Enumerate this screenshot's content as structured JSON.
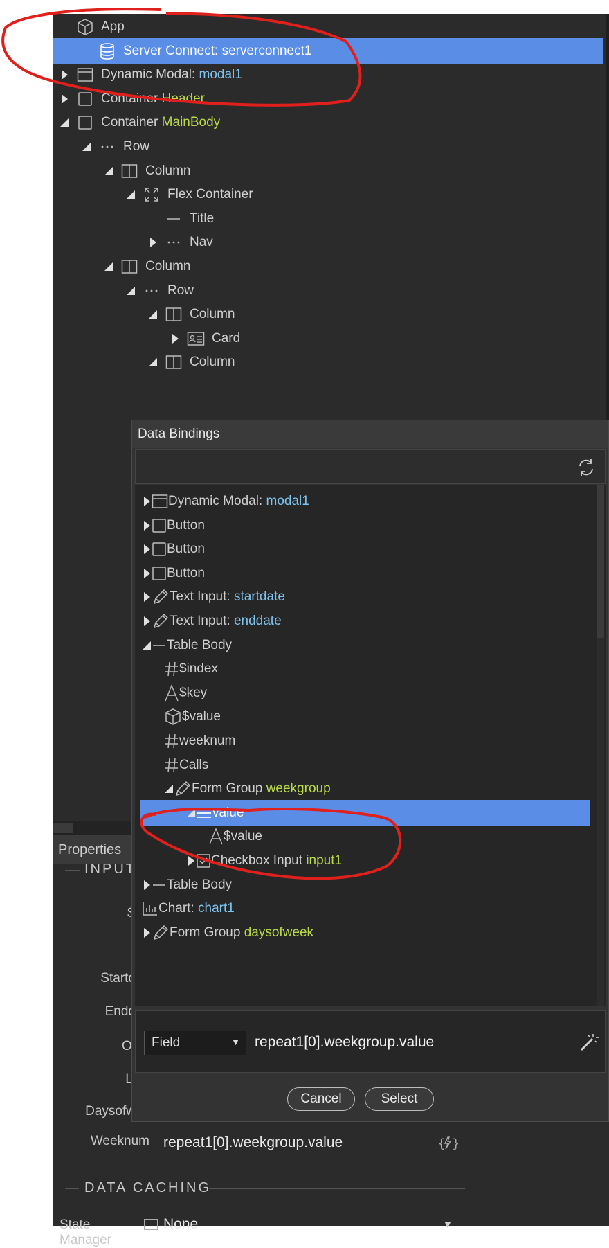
{
  "tree": {
    "items": [
      {
        "label": "App",
        "highlight": "",
        "hl_color": "",
        "icon": "cube-icon",
        "depth": 0,
        "toggle": "none",
        "selected": false
      },
      {
        "label": "Server Connect: serverconnect1",
        "highlight": "",
        "hl_color": "",
        "icon": "database-icon",
        "depth": 1,
        "toggle": "none",
        "selected": true
      },
      {
        "label": "Dynamic Modal: ",
        "highlight": "modal1",
        "hl_color": "blue",
        "icon": "modal-icon",
        "depth": 0,
        "toggle": "right",
        "selected": false
      },
      {
        "label": "Container ",
        "highlight": "Header",
        "hl_color": "green",
        "icon": "container-icon",
        "depth": 0,
        "toggle": "right",
        "selected": false
      },
      {
        "label": "Container ",
        "highlight": "MainBody",
        "hl_color": "green",
        "icon": "container-icon",
        "depth": 0,
        "toggle": "down",
        "selected": false
      },
      {
        "label": "Row",
        "highlight": "",
        "hl_color": "",
        "icon": "dots-icon",
        "depth": 1,
        "toggle": "down",
        "selected": false
      },
      {
        "label": "Column",
        "highlight": "",
        "hl_color": "",
        "icon": "column-icon",
        "depth": 2,
        "toggle": "down",
        "selected": false
      },
      {
        "label": "Flex Container",
        "highlight": "",
        "hl_color": "",
        "icon": "flex-icon",
        "depth": 3,
        "toggle": "down",
        "selected": false
      },
      {
        "label": "Title",
        "highlight": "",
        "hl_color": "",
        "icon": "dash-icon",
        "depth": 4,
        "toggle": "none",
        "selected": false
      },
      {
        "label": "Nav",
        "highlight": "",
        "hl_color": "",
        "icon": "dots-icon",
        "depth": 4,
        "toggle": "right",
        "selected": false
      },
      {
        "label": "Column",
        "highlight": "",
        "hl_color": "",
        "icon": "column-icon",
        "depth": 2,
        "toggle": "down",
        "selected": false
      },
      {
        "label": "Row",
        "highlight": "",
        "hl_color": "",
        "icon": "dots-icon",
        "depth": 3,
        "toggle": "down",
        "selected": false
      },
      {
        "label": "Column",
        "highlight": "",
        "hl_color": "",
        "icon": "column-icon",
        "depth": 4,
        "toggle": "down",
        "selected": false
      },
      {
        "label": "Card",
        "highlight": "",
        "hl_color": "",
        "icon": "card-icon",
        "depth": 5,
        "toggle": "right",
        "selected": false
      },
      {
        "label": "Column",
        "highlight": "",
        "hl_color": "",
        "icon": "column-icon",
        "depth": 4,
        "toggle": "down",
        "selected": false
      }
    ]
  },
  "properties": {
    "tab_label": "Properties",
    "section_input": "INPUT",
    "labels": [
      "S",
      "Startd",
      "Endd",
      "Of",
      "Li",
      "Daysofw"
    ],
    "weeknum_label": "Weeknum",
    "weeknum_value": "repeat1[0].weekgroup.value",
    "section_caching": "DATA CACHING",
    "state_manager_label": "State Manager",
    "state_manager_value": "None"
  },
  "modal": {
    "title": "Data Bindings",
    "items": [
      {
        "label": "Dynamic Modal: ",
        "highlight": "modal1",
        "hl_color": "blue",
        "icon": "modal-icon",
        "depth": 0,
        "toggle": "right",
        "selected": false
      },
      {
        "label": "Button",
        "highlight": "",
        "hl_color": "",
        "icon": "container-icon",
        "depth": 0,
        "toggle": "right",
        "selected": false
      },
      {
        "label": "Button",
        "highlight": "",
        "hl_color": "",
        "icon": "container-icon",
        "depth": 0,
        "toggle": "right",
        "selected": false
      },
      {
        "label": "Button",
        "highlight": "",
        "hl_color": "",
        "icon": "container-icon",
        "depth": 0,
        "toggle": "right",
        "selected": false
      },
      {
        "label": "Text Input: ",
        "highlight": "startdate",
        "hl_color": "blue",
        "icon": "pencil-icon",
        "depth": 0,
        "toggle": "right",
        "selected": false
      },
      {
        "label": "Text Input: ",
        "highlight": "enddate",
        "hl_color": "blue",
        "icon": "pencil-icon",
        "depth": 0,
        "toggle": "right",
        "selected": false
      },
      {
        "label": "Table Body",
        "highlight": "",
        "hl_color": "",
        "icon": "dash-icon",
        "depth": 0,
        "toggle": "down",
        "selected": false
      },
      {
        "label": "$index",
        "highlight": "",
        "hl_color": "",
        "icon": "hash-icon",
        "depth": 1,
        "toggle": "none",
        "selected": false
      },
      {
        "label": "$key",
        "highlight": "",
        "hl_color": "",
        "icon": "text-a-icon",
        "depth": 1,
        "toggle": "none",
        "selected": false
      },
      {
        "label": "$value",
        "highlight": "",
        "hl_color": "",
        "icon": "cube-icon",
        "depth": 1,
        "toggle": "none",
        "selected": false
      },
      {
        "label": "weeknum",
        "highlight": "",
        "hl_color": "",
        "icon": "hash-icon",
        "depth": 1,
        "toggle": "none",
        "selected": false
      },
      {
        "label": "Calls",
        "highlight": "",
        "hl_color": "",
        "icon": "hash-icon",
        "depth": 1,
        "toggle": "none",
        "selected": false
      },
      {
        "label": "Form Group ",
        "highlight": "weekgroup",
        "hl_color": "green",
        "icon": "pencil-icon",
        "depth": 1,
        "toggle": "down",
        "selected": false
      },
      {
        "label": "value",
        "highlight": "",
        "hl_color": "",
        "icon": "list-icon",
        "depth": 2,
        "toggle": "down",
        "selected": true
      },
      {
        "label": "$value",
        "highlight": "",
        "hl_color": "",
        "icon": "text-a-icon",
        "depth": 3,
        "toggle": "none",
        "selected": false
      },
      {
        "label": "Checkbox Input ",
        "highlight": "input1",
        "hl_color": "green",
        "icon": "checkbox-icon",
        "depth": 2,
        "toggle": "right",
        "selected": false
      },
      {
        "label": "Table Body",
        "highlight": "",
        "hl_color": "",
        "icon": "dash-icon",
        "depth": 0,
        "toggle": "right",
        "selected": false
      },
      {
        "label": "Chart: ",
        "highlight": "chart1",
        "hl_color": "blue",
        "icon": "chart-icon",
        "depth": 0,
        "toggle": "none",
        "selected": false
      },
      {
        "label": "Form Group ",
        "highlight": "daysofweek",
        "hl_color": "green",
        "icon": "pencil-icon",
        "depth": 0,
        "toggle": "right",
        "selected": false
      }
    ],
    "select_value": "Field",
    "expression": "repeat1[0].weekgroup.value",
    "cancel_label": "Cancel",
    "select_label": "Select"
  },
  "colors": {
    "annotation": "#e0201c",
    "selection": "#5a8ee6",
    "highlight_blue": "#7fc4ee",
    "highlight_green": "#b9d94a"
  }
}
